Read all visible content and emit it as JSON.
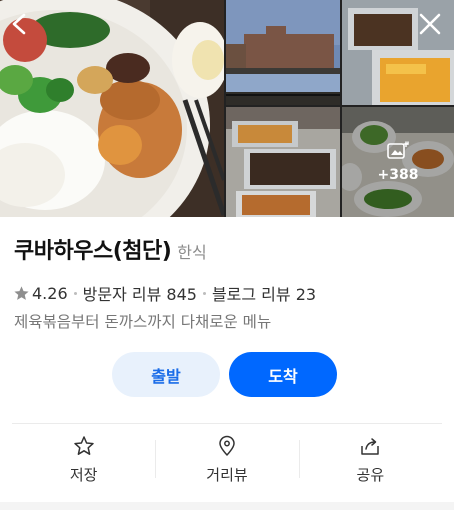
{
  "gallery": {
    "more_count": "+388"
  },
  "place": {
    "name": "쿠바하우스(첨단)",
    "category": "한식",
    "rating": "4.26",
    "visitor_reviews": "방문자 리뷰 845",
    "blog_reviews": "블로그 리뷰 23",
    "description": "제육볶음부터 돈까스까지 다채로운 메뉴"
  },
  "buttons": {
    "depart": "출발",
    "arrive": "도착"
  },
  "actions": [
    {
      "label": "저장",
      "icon": "star-outline-icon"
    },
    {
      "label": "거리뷰",
      "icon": "map-pin-icon"
    },
    {
      "label": "공유",
      "icon": "share-icon"
    }
  ],
  "colors": {
    "primary": "#0068ff",
    "primary_soft": "#e8f1fc",
    "primary_text": "#1a6ce8",
    "muted": "#8c8c8c"
  }
}
